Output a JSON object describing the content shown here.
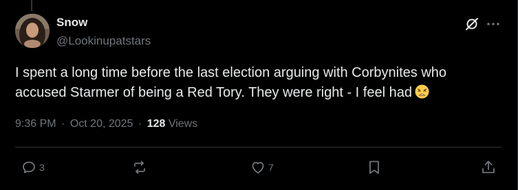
{
  "tweet": {
    "author": {
      "name": "Snow",
      "handle": "@Lookinupatstars"
    },
    "text": "I spent a long time before the last election arguing with Corbynites who accused Starmer of being a Red Tory. They were right - I feel had",
    "emoji_icon": "weary-face-emoji",
    "time": "9:36 PM",
    "date": "Oct 20, 2025",
    "separator": "·",
    "views_count": "128",
    "views_label": "Views"
  },
  "actions": {
    "replies": "3",
    "reposts": "",
    "likes": "7"
  },
  "icons": {
    "grok": "grok-icon",
    "more": "more-icon",
    "reply": "reply-icon",
    "repost": "repost-icon",
    "like": "heart-icon",
    "bookmark": "bookmark-icon",
    "share": "share-icon"
  },
  "colors": {
    "background": "#000000",
    "text_primary": "#e7e9ea",
    "text_secondary": "#71767b",
    "divider": "#2f3336"
  }
}
